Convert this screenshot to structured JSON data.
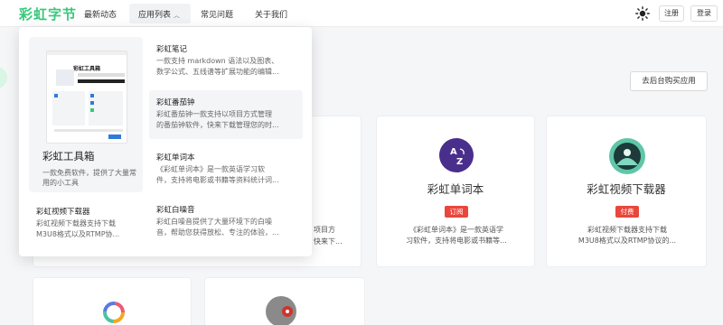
{
  "header": {
    "logo": "彩虹字节",
    "nav": [
      "最新动态",
      "应用列表",
      "常见问题",
      "关于我们"
    ],
    "register": "注册",
    "login": "登录"
  },
  "page": {
    "buy_button": "去后台购买应用",
    "cards": [
      {
        "title": "彩虹单词本",
        "badge": "订阅",
        "desc": "《彩虹单词本》是一款英语学\n习软件，支持将电影或书籍等..."
      },
      {
        "title": "彩虹视频下载器",
        "badge": "付费",
        "desc": "彩虹视频下载器支持下载\nM3U8格式以及RTMP协议的..."
      }
    ],
    "peek_fragments": [
      "项目方",
      "快来下..."
    ]
  },
  "dropdown": {
    "featured": {
      "screenshot_title": "彩虹工具箱",
      "title": "彩虹工具箱",
      "desc": "一款免费软件，提供了大量常用的小工具"
    },
    "items": [
      {
        "title": "彩虹笔记",
        "desc": "一款支持 markdown 语法以及图表、\n数学公式、五线谱等扩展功能的编辑..."
      },
      {
        "title": "彩虹番茄钟",
        "desc": "彩虹番茄钟一款支持以项目方式管理\n的番茄钟软件，快来下载管理您的时..."
      },
      {
        "title": "彩虹单词本",
        "desc": "《彩虹单词本》是一款英语学习软\n件，支持将电影或书籍等资料统计词..."
      },
      {
        "title": "彩虹白噪音",
        "desc": "彩虹白噪音提供了大量环境下的白噪\n音，帮助您获得放松、专注的体验，..."
      },
      {
        "title": "彩虹视频下载器",
        "desc": "彩虹视频下载器支持下载\nM3U8格式以及RTMP协..."
      }
    ]
  },
  "colors": {
    "brand": "#37c87a",
    "badge": "#e9463c"
  }
}
